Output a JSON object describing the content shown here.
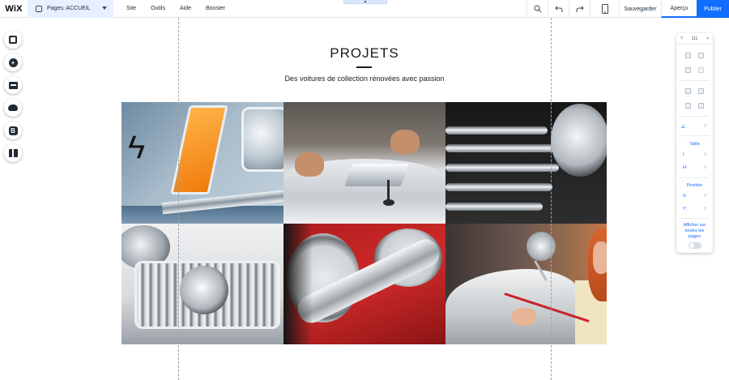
{
  "topbar": {
    "logo": "WiX",
    "pages_label": "Pages: ACCUEIL",
    "menu": [
      "Site",
      "Outils",
      "Aide",
      "Booster"
    ],
    "save_label": "Sauvegarder",
    "preview_label": "Aperçu",
    "publish_label": "Publier",
    "accent_color": "#116dff",
    "tools": [
      "zoom-icon",
      "undo-icon",
      "redo-icon",
      "mobile-icon"
    ]
  },
  "left_rail": [
    "background-icon",
    "add-icon",
    "add-apps-icon",
    "upload-icon",
    "blog-icon",
    "market-icon"
  ],
  "content": {
    "title": "PROJETS",
    "subtitle": "Des voitures de collection rénovées avec passion"
  },
  "gallery": {
    "images": [
      "blue-car-headlight",
      "hands-on-white-car",
      "chrome-grille",
      "white-car-grille",
      "red-dashboard-gauges",
      "woman-with-mirror"
    ]
  },
  "panel": {
    "help": "?",
    "size_icon": "111",
    "close": "×",
    "angle_value": "0°",
    "size_label": "Taille",
    "w_label": "l:",
    "w_value": "0",
    "h_label": "H:",
    "h_value": "0",
    "position_label": "Position",
    "x_label": "X:",
    "x_value": "0",
    "y_label": "Y:",
    "y_value": "0",
    "show_all_label": "Afficher sur toutes les pages"
  }
}
